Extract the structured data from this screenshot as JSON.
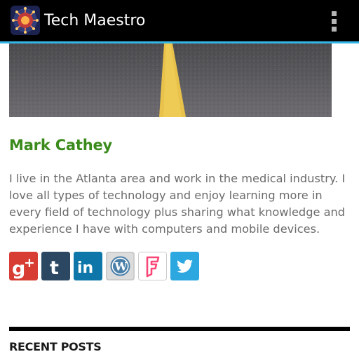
{
  "app": {
    "title": "Tech Maestro",
    "accent_color": "#33b5e5",
    "icon": "virus-logo-icon",
    "menu_icon": "overflow-menu-icon"
  },
  "author": {
    "name": "Mark Cathey",
    "name_color": "#3a8a1c",
    "bio": "I live in the Atlanta area and work in the medical industry. I love all types of technology and enjoy learning more in every field of technology plus sharing what knowledge and experience I have with computers and mobile devices."
  },
  "social_links": [
    {
      "icon": "google-plus-icon",
      "color": "#d73d32"
    },
    {
      "icon": "tumblr-icon",
      "color": "#2c4762"
    },
    {
      "icon": "linkedin-icon",
      "color": "#0e76a8"
    },
    {
      "icon": "wordpress-icon",
      "color": "#dcdcdc"
    },
    {
      "icon": "foursquare-icon",
      "color": "#f94877"
    },
    {
      "icon": "twitter-icon",
      "color": "#2ca7e0"
    }
  ],
  "recent_posts": {
    "heading": "RECENT POSTS"
  }
}
